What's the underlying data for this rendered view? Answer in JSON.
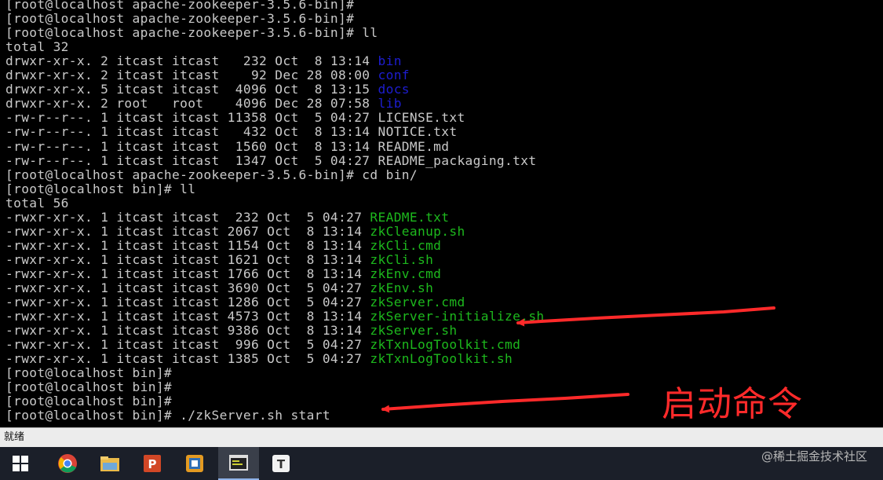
{
  "terminal": {
    "lines": [
      [
        {
          "t": "[root@localhost apache-zookeeper-3.5.6-bin]#"
        }
      ],
      [
        {
          "t": "[root@localhost apache-zookeeper-3.5.6-bin]#"
        }
      ],
      [
        {
          "t": "[root@localhost apache-zookeeper-3.5.6-bin]# ll"
        }
      ],
      [
        {
          "t": "total 32"
        }
      ],
      [
        {
          "t": "drwxr-xr-x. 2 itcast itcast   232 Oct  8 13:14 "
        },
        {
          "t": "bin",
          "c": "blue"
        }
      ],
      [
        {
          "t": "drwxr-xr-x. 2 itcast itcast    92 Dec 28 08:00 "
        },
        {
          "t": "conf",
          "c": "blue"
        }
      ],
      [
        {
          "t": "drwxr-xr-x. 5 itcast itcast  4096 Oct  8 13:15 "
        },
        {
          "t": "docs",
          "c": "blue"
        }
      ],
      [
        {
          "t": "drwxr-xr-x. 2 root   root    4096 Dec 28 07:58 "
        },
        {
          "t": "lib",
          "c": "blue"
        }
      ],
      [
        {
          "t": "-rw-r--r--. 1 itcast itcast 11358 Oct  5 04:27 LICENSE.txt"
        }
      ],
      [
        {
          "t": "-rw-r--r--. 1 itcast itcast   432 Oct  8 13:14 NOTICE.txt"
        }
      ],
      [
        {
          "t": "-rw-r--r--. 1 itcast itcast  1560 Oct  8 13:14 README.md"
        }
      ],
      [
        {
          "t": "-rw-r--r--. 1 itcast itcast  1347 Oct  5 04:27 README_packaging.txt"
        }
      ],
      [
        {
          "t": "[root@localhost apache-zookeeper-3.5.6-bin]# cd bin/"
        }
      ],
      [
        {
          "t": "[root@localhost bin]# ll"
        }
      ],
      [
        {
          "t": "total 56"
        }
      ],
      [
        {
          "t": "-rwxr-xr-x. 1 itcast itcast  232 Oct  5 04:27 "
        },
        {
          "t": "README.txt",
          "c": "green"
        }
      ],
      [
        {
          "t": "-rwxr-xr-x. 1 itcast itcast 2067 Oct  8 13:14 "
        },
        {
          "t": "zkCleanup.sh",
          "c": "green"
        }
      ],
      [
        {
          "t": "-rwxr-xr-x. 1 itcast itcast 1154 Oct  8 13:14 "
        },
        {
          "t": "zkCli.cmd",
          "c": "green"
        }
      ],
      [
        {
          "t": "-rwxr-xr-x. 1 itcast itcast 1621 Oct  8 13:14 "
        },
        {
          "t": "zkCli.sh",
          "c": "green"
        }
      ],
      [
        {
          "t": "-rwxr-xr-x. 1 itcast itcast 1766 Oct  8 13:14 "
        },
        {
          "t": "zkEnv.cmd",
          "c": "green"
        }
      ],
      [
        {
          "t": "-rwxr-xr-x. 1 itcast itcast 3690 Oct  5 04:27 "
        },
        {
          "t": "zkEnv.sh",
          "c": "green"
        }
      ],
      [
        {
          "t": "-rwxr-xr-x. 1 itcast itcast 1286 Oct  5 04:27 "
        },
        {
          "t": "zkServer.cmd",
          "c": "green"
        }
      ],
      [
        {
          "t": "-rwxr-xr-x. 1 itcast itcast 4573 Oct  8 13:14 "
        },
        {
          "t": "zkServer-initialize.sh",
          "c": "green"
        }
      ],
      [
        {
          "t": "-rwxr-xr-x. 1 itcast itcast 9386 Oct  8 13:14 "
        },
        {
          "t": "zkServer.sh",
          "c": "green"
        }
      ],
      [
        {
          "t": "-rwxr-xr-x. 1 itcast itcast  996 Oct  5 04:27 "
        },
        {
          "t": "zkTxnLogToolkit.cmd",
          "c": "green"
        }
      ],
      [
        {
          "t": "-rwxr-xr-x. 1 itcast itcast 1385 Oct  5 04:27 "
        },
        {
          "t": "zkTxnLogToolkit.sh",
          "c": "green"
        }
      ],
      [
        {
          "t": "[root@localhost bin]#"
        }
      ],
      [
        {
          "t": "[root@localhost bin]#"
        }
      ],
      [
        {
          "t": "[root@localhost bin]#"
        }
      ],
      [
        {
          "t": "[root@localhost bin]# ./zkServer.sh start"
        }
      ]
    ]
  },
  "annotation": {
    "label": "启动命令",
    "color": "#ff2a2a"
  },
  "statusbar": {
    "text": "就绪"
  },
  "taskbar": {
    "icons": [
      "windows-start-icon",
      "chrome-icon",
      "file-explorer-icon",
      "powerpoint-icon",
      "app-icon",
      "terminal-app-icon",
      "typora-icon"
    ]
  },
  "watermark": {
    "text": "@稀土掘金技术社区"
  },
  "colors": {
    "terminal_bg": "#000000",
    "default_text": "#c9c9c9",
    "dir_blue": "#1d1dd0",
    "exec_green": "#1db81d"
  }
}
